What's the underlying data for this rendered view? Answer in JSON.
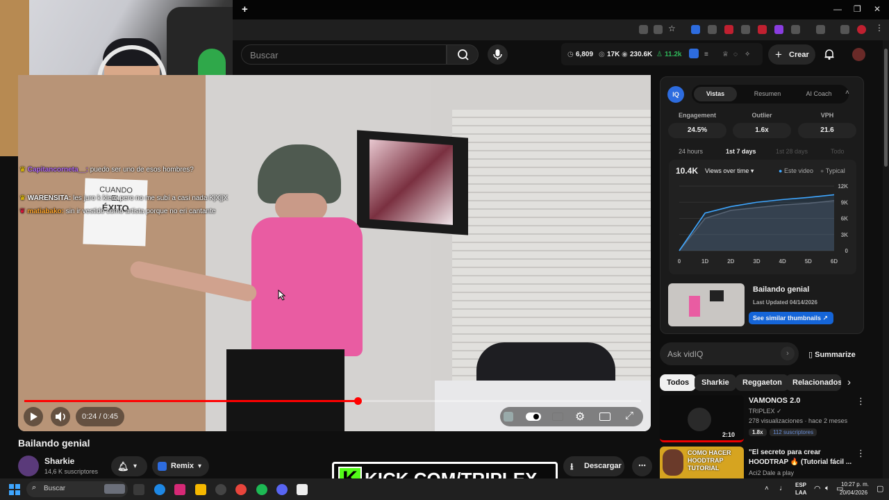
{
  "browser": {
    "new_tab_label": "+",
    "window_controls": [
      "—",
      "❐",
      "✕"
    ]
  },
  "chat": [
    {
      "user": "Capitancorneta__:",
      "text": " puedo ser uno de esos hombres?",
      "color": "#b46cf5"
    },
    {
      "user": "WARENSITA:",
      "text": " les juro k kiero pero no me subí a casi nada KjXjjX",
      "color": "#ffffff"
    },
    {
      "user": "matiabako:",
      "text": " sin ir vestido como artista porque no eri cantante",
      "color": "#ffa52c"
    }
  ],
  "masthead": {
    "search_placeholder": "Buscar",
    "stats": {
      "a": "6,809",
      "b": "17K",
      "c": "230.6K",
      "d": "11.2k"
    },
    "create_label": "Crear"
  },
  "player": {
    "time": "0:24 / 0:45",
    "progress": 0.54,
    "poster_lines": [
      "CUANDO",
      "EL",
      "ÉXITO"
    ]
  },
  "video": {
    "title": "Bailando genial",
    "channel": "Sharkie",
    "subscribers": "14,6 K suscriptores",
    "remix_label": "Remix",
    "download_label": "Descargar"
  },
  "overlay_banner": "KICK.COM/TRIPLEX",
  "vidiq": {
    "tabs": [
      "Vistas",
      "Resumen",
      "AI Coach"
    ],
    "metrics": [
      {
        "label": "Engagement",
        "value": "24.5%"
      },
      {
        "label": "Outlier",
        "value": "1.6x"
      },
      {
        "label": "VPH",
        "value": "21.6"
      }
    ],
    "ranges": [
      "24 hours",
      "1st 7 days",
      "1st 28 days",
      "Todo"
    ],
    "total": "10.4K",
    "dropdown": "Views over time",
    "legend": [
      "Este video",
      "Typical"
    ],
    "thumb_title": "Bailando genial",
    "thumb_updated": "Last Updated 04/14/2026",
    "similar_btn": "See similar thumbnails"
  },
  "chart_data": {
    "type": "area",
    "x": [
      "0",
      "1D",
      "2D",
      "3D",
      "4D",
      "5D",
      "6D"
    ],
    "y_ticks": [
      "12K",
      "9K",
      "6K",
      "3K",
      "0"
    ],
    "ylim": [
      0,
      12000
    ],
    "series": [
      {
        "name": "Este video",
        "values": [
          0,
          7000,
          8200,
          9000,
          9500,
          9900,
          10400
        ],
        "color": "#3ea6ff"
      },
      {
        "values": [
          0,
          6000,
          7500,
          8000,
          8500,
          8800,
          9300
        ],
        "color": "#5a5a60"
      }
    ],
    "grid": true
  },
  "ask": {
    "placeholder": "Ask vidIQ",
    "summarize": "Summarize"
  },
  "chips": [
    "Todos",
    "Sharkie",
    "Reggaeton",
    "Relacionados"
  ],
  "recommended": [
    {
      "title": "VAMONOS 2.0",
      "channel": "TRIPLEX",
      "meta": "278 visualizaciones · hace 2 meses",
      "badge": "1.8x",
      "subs": "112 suscriptores",
      "duration": "2:10"
    },
    {
      "title": "\"El secreto para crear HOODTRAP 🔥 (Tutorial fácil ...",
      "channel": "Aci2 Dale a play",
      "thumb_text": "COMO HACER HOODTRAP TUTORIAL"
    }
  ],
  "taskbar": {
    "search_placeholder": "Buscar",
    "lang": "ESP",
    "lang2": "LAA",
    "time": "10:27 p. m.",
    "date": "20/04/2026"
  }
}
